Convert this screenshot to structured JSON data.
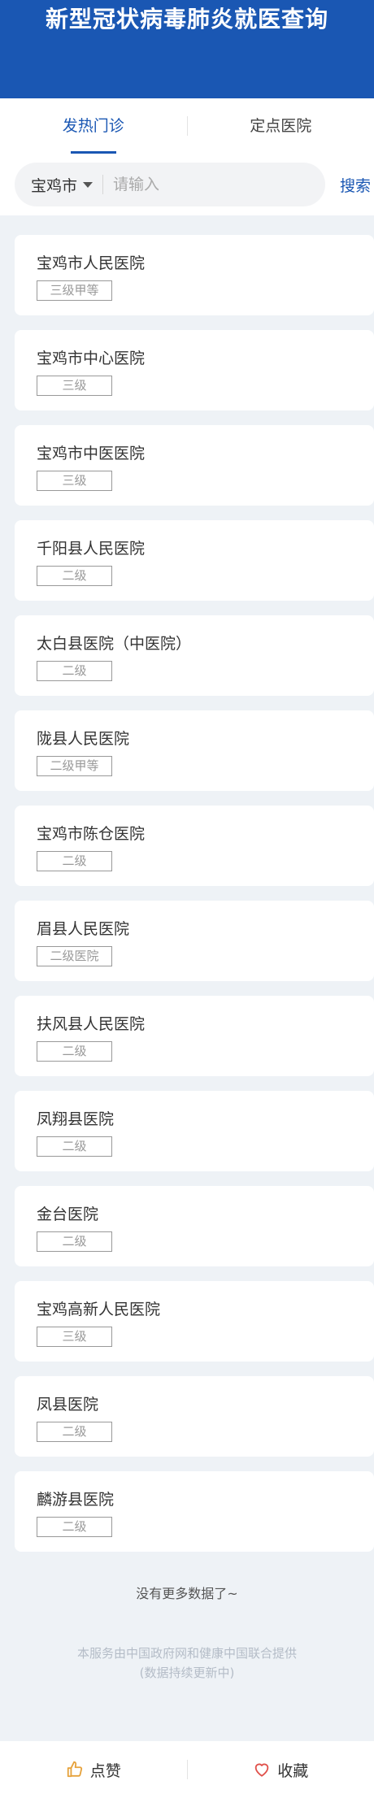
{
  "header": {
    "title": "新型冠状病毒肺炎就医查询"
  },
  "tabs": [
    {
      "label": "发热门诊",
      "active": true
    },
    {
      "label": "定点医院",
      "active": false
    }
  ],
  "search": {
    "city": "宝鸡市",
    "placeholder": "请输入",
    "button_label": "搜索"
  },
  "hospitals": [
    {
      "name": "宝鸡市人民医院",
      "level": "三级甲等"
    },
    {
      "name": "宝鸡市中心医院",
      "level": "三级"
    },
    {
      "name": "宝鸡市中医医院",
      "level": "三级"
    },
    {
      "name": "千阳县人民医院",
      "level": "二级"
    },
    {
      "name": "太白县医院（中医院）",
      "level": "二级"
    },
    {
      "name": "陇县人民医院",
      "level": "二级甲等"
    },
    {
      "name": "宝鸡市陈仓医院",
      "level": "二级"
    },
    {
      "name": "眉县人民医院",
      "level": "二级医院"
    },
    {
      "name": "扶风县人民医院",
      "level": "二级"
    },
    {
      "name": "凤翔县医院",
      "level": "二级"
    },
    {
      "name": "金台医院",
      "level": "二级"
    },
    {
      "name": "宝鸡高新人民医院",
      "level": "三级"
    },
    {
      "name": "凤县医院",
      "level": "二级"
    },
    {
      "name": "麟游县医院",
      "level": "二级"
    }
  ],
  "list_end": "没有更多数据了~",
  "footer": {
    "line1": "本服务由中国政府网和健康中国联合提供",
    "line2": "(数据持续更新中)"
  },
  "bottom_bar": {
    "like_label": "点赞",
    "like_icon": "thumbs-up-icon",
    "favorite_label": "收藏",
    "favorite_icon": "heart-icon",
    "like_icon_color": "#e6a23c",
    "favorite_icon_color": "#e0504a"
  },
  "colors": {
    "brand": "#1a57b3"
  }
}
